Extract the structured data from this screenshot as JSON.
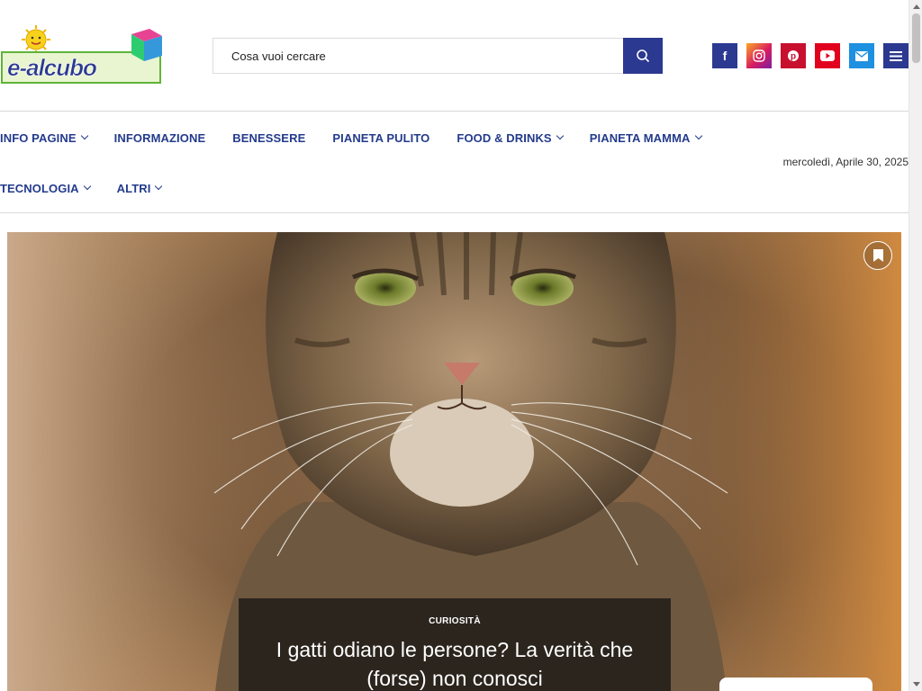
{
  "site": {
    "logo_text": "e-alcubo",
    "colors": {
      "brand_blue": "#2b3990",
      "nav_blue": "#233b8c"
    }
  },
  "search": {
    "placeholder": "Cosa vuoi cercare",
    "icon": "search-icon"
  },
  "socials": [
    {
      "name": "facebook",
      "icon": "f",
      "color": "#2b3990"
    },
    {
      "name": "instagram",
      "icon": "◎",
      "color": "#b936a6"
    },
    {
      "name": "pinterest",
      "icon": "P",
      "color": "#c8102e"
    },
    {
      "name": "youtube",
      "icon": "▶",
      "color": "#e1001e"
    },
    {
      "name": "email",
      "icon": "✉",
      "color": "#1e90e0"
    },
    {
      "name": "menu",
      "icon": "≡",
      "color": "#2b3990"
    }
  ],
  "nav": {
    "row1": [
      {
        "label": "INFO PAGINE",
        "dropdown": true
      },
      {
        "label": "INFORMAZIONE",
        "dropdown": false
      },
      {
        "label": "BENESSERE",
        "dropdown": false
      },
      {
        "label": "PIANETA PULITO",
        "dropdown": false
      },
      {
        "label": "FOOD & DRINKS",
        "dropdown": true
      },
      {
        "label": "PIANETA MAMMA",
        "dropdown": true
      }
    ],
    "row2": [
      {
        "label": "TECNOLOGIA",
        "dropdown": true
      },
      {
        "label": "ALTRI",
        "dropdown": true
      }
    ],
    "date": "mercoledì, Aprile 30, 2025"
  },
  "hero": {
    "category": "CURIOSITÀ",
    "title": "I gatti odiano le persone? La verità che (forse) non conosci",
    "bookmark_icon": "bookmark-icon"
  }
}
